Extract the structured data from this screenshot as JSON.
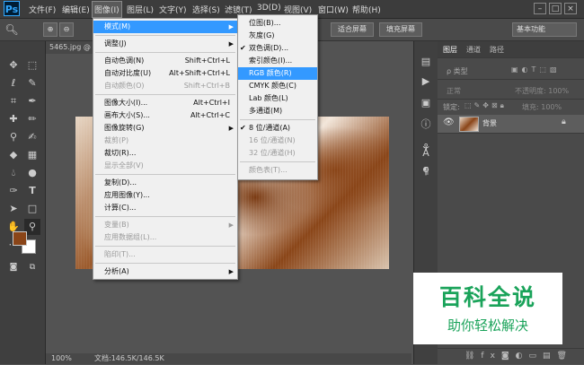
{
  "app": {
    "logo": "Ps"
  },
  "menubar": {
    "items": [
      "文件(F)",
      "编辑(E)",
      "图像(I)",
      "图层(L)",
      "文字(Y)",
      "选择(S)",
      "滤镜(T)",
      "3D(D)",
      "视图(V)",
      "窗口(W)",
      "帮助(H)"
    ],
    "active_index": 2
  },
  "options_bar": {
    "fit_screen": "适合屏幕",
    "fill_screen": "填充屏幕",
    "workspace": "基本功能"
  },
  "document": {
    "tab": "5465.jpg @",
    "zoom": "100%",
    "doc_info": "文档:146.5K/146.5K"
  },
  "image_menu": {
    "items": [
      {
        "label": "模式(M)",
        "shortcut": "",
        "submenu": true,
        "disabled": false,
        "highlight": true
      },
      {
        "sep": true
      },
      {
        "label": "调整(J)",
        "shortcut": "",
        "submenu": true,
        "disabled": false
      },
      {
        "sep": true
      },
      {
        "label": "自动色调(N)",
        "shortcut": "Shift+Ctrl+L",
        "disabled": false
      },
      {
        "label": "自动对比度(U)",
        "shortcut": "Alt+Shift+Ctrl+L",
        "disabled": false
      },
      {
        "label": "自动颜色(O)",
        "shortcut": "Shift+Ctrl+B",
        "disabled": true
      },
      {
        "sep": true
      },
      {
        "label": "图像大小(I)...",
        "shortcut": "Alt+Ctrl+I",
        "disabled": false
      },
      {
        "label": "画布大小(S)...",
        "shortcut": "Alt+Ctrl+C",
        "disabled": false
      },
      {
        "label": "图像旋转(G)",
        "shortcut": "",
        "submenu": true,
        "disabled": false
      },
      {
        "label": "裁剪(P)",
        "shortcut": "",
        "disabled": true
      },
      {
        "label": "裁切(R)...",
        "shortcut": "",
        "disabled": false
      },
      {
        "label": "显示全部(V)",
        "shortcut": "",
        "disabled": true
      },
      {
        "sep": true
      },
      {
        "label": "复制(D)...",
        "shortcut": "",
        "disabled": false
      },
      {
        "label": "应用图像(Y)...",
        "shortcut": "",
        "disabled": false
      },
      {
        "label": "计算(C)...",
        "shortcut": "",
        "disabled": false
      },
      {
        "sep": true
      },
      {
        "label": "变量(B)",
        "shortcut": "",
        "submenu": true,
        "disabled": true
      },
      {
        "label": "应用数据组(L)...",
        "shortcut": "",
        "disabled": true
      },
      {
        "sep": true
      },
      {
        "label": "陷印(T)...",
        "shortcut": "",
        "disabled": true
      },
      {
        "sep": true
      },
      {
        "label": "分析(A)",
        "shortcut": "",
        "submenu": true,
        "disabled": false
      }
    ]
  },
  "mode_submenu": {
    "items": [
      {
        "label": "位图(B)...",
        "disabled": false
      },
      {
        "label": "灰度(G)",
        "disabled": false
      },
      {
        "label": "双色调(D)...",
        "disabled": false,
        "checked": true
      },
      {
        "label": "索引颜色(I)...",
        "disabled": false
      },
      {
        "label": "RGB 颜色(R)",
        "disabled": false,
        "highlight": true
      },
      {
        "label": "CMYK 颜色(C)",
        "disabled": false
      },
      {
        "label": "Lab 颜色(L)",
        "disabled": false
      },
      {
        "label": "多通道(M)",
        "disabled": false
      },
      {
        "sep": true
      },
      {
        "label": "8 位/通道(A)",
        "disabled": false,
        "checked": true
      },
      {
        "label": "16 位/通道(N)",
        "disabled": true
      },
      {
        "label": "32 位/通道(H)",
        "disabled": true
      },
      {
        "sep": true
      },
      {
        "label": "颜色表(T)...",
        "disabled": true
      }
    ]
  },
  "layers_panel": {
    "tabs": [
      "图层",
      "通道",
      "路径"
    ],
    "filter_label": "ρ 类型",
    "blend_mode": "正常",
    "opacity_label": "不透明度: 100%",
    "lock_label": "锁定:",
    "fill_label": "填充: 100%",
    "layer_name": "背景"
  },
  "colors": {
    "foreground": "#8a4518",
    "background": "#ffffff",
    "accent": "#3399ff"
  },
  "watermark": {
    "title": "百科全说",
    "subtitle": "助你轻松解决"
  }
}
